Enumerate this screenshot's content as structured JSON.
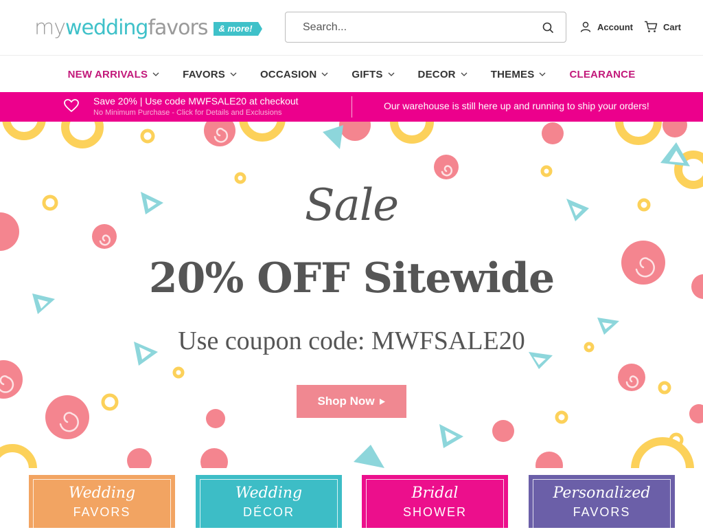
{
  "header": {
    "logo": {
      "my": "my",
      "wedding": "wedding",
      "favors": "favors",
      "more": "& more!"
    },
    "search": {
      "placeholder": "Search...",
      "value": ""
    },
    "account_label": "Account",
    "cart_label": "Cart"
  },
  "nav": {
    "items": [
      {
        "label": "NEW ARRIVALS",
        "has_dropdown": true,
        "color": "#c2187a"
      },
      {
        "label": "FAVORS",
        "has_dropdown": true
      },
      {
        "label": "OCCASION",
        "has_dropdown": true
      },
      {
        "label": "GIFTS",
        "has_dropdown": true
      },
      {
        "label": "DECOR",
        "has_dropdown": true
      },
      {
        "label": "THEMES",
        "has_dropdown": true
      },
      {
        "label": "CLEARANCE",
        "has_dropdown": false,
        "color": "#c2187a"
      }
    ]
  },
  "promo": {
    "line1": "Save 20% | Use code MWFSALE20 at checkout",
    "line2": "No Minimum Purchase - Click for Details and Exclusions",
    "right": "Our warehouse is still here up and running to ship your orders!",
    "background": "#ec008c"
  },
  "hero": {
    "sale": "Sale",
    "headline": "20% OFF Sitewide",
    "coupon": "Use coupon code: MWFSALE20",
    "button_label": "Shop Now",
    "button_color": "#f08891"
  },
  "tiles": [
    {
      "script": "Wedding",
      "caps": "FAVORS",
      "color": "#f2a462"
    },
    {
      "script": "Wedding",
      "caps": "DÉCOR",
      "color": "#3dbdc6"
    },
    {
      "script": "Bridal",
      "caps": "SHOWER",
      "color": "#ec0f8c"
    },
    {
      "script": "Personalized",
      "caps": "FAVORS",
      "color": "#6b5fa8"
    }
  ],
  "colors": {
    "brand_teal": "#3fc1c9",
    "brand_pink": "#ec008c",
    "nav_pink": "#c2187a"
  }
}
